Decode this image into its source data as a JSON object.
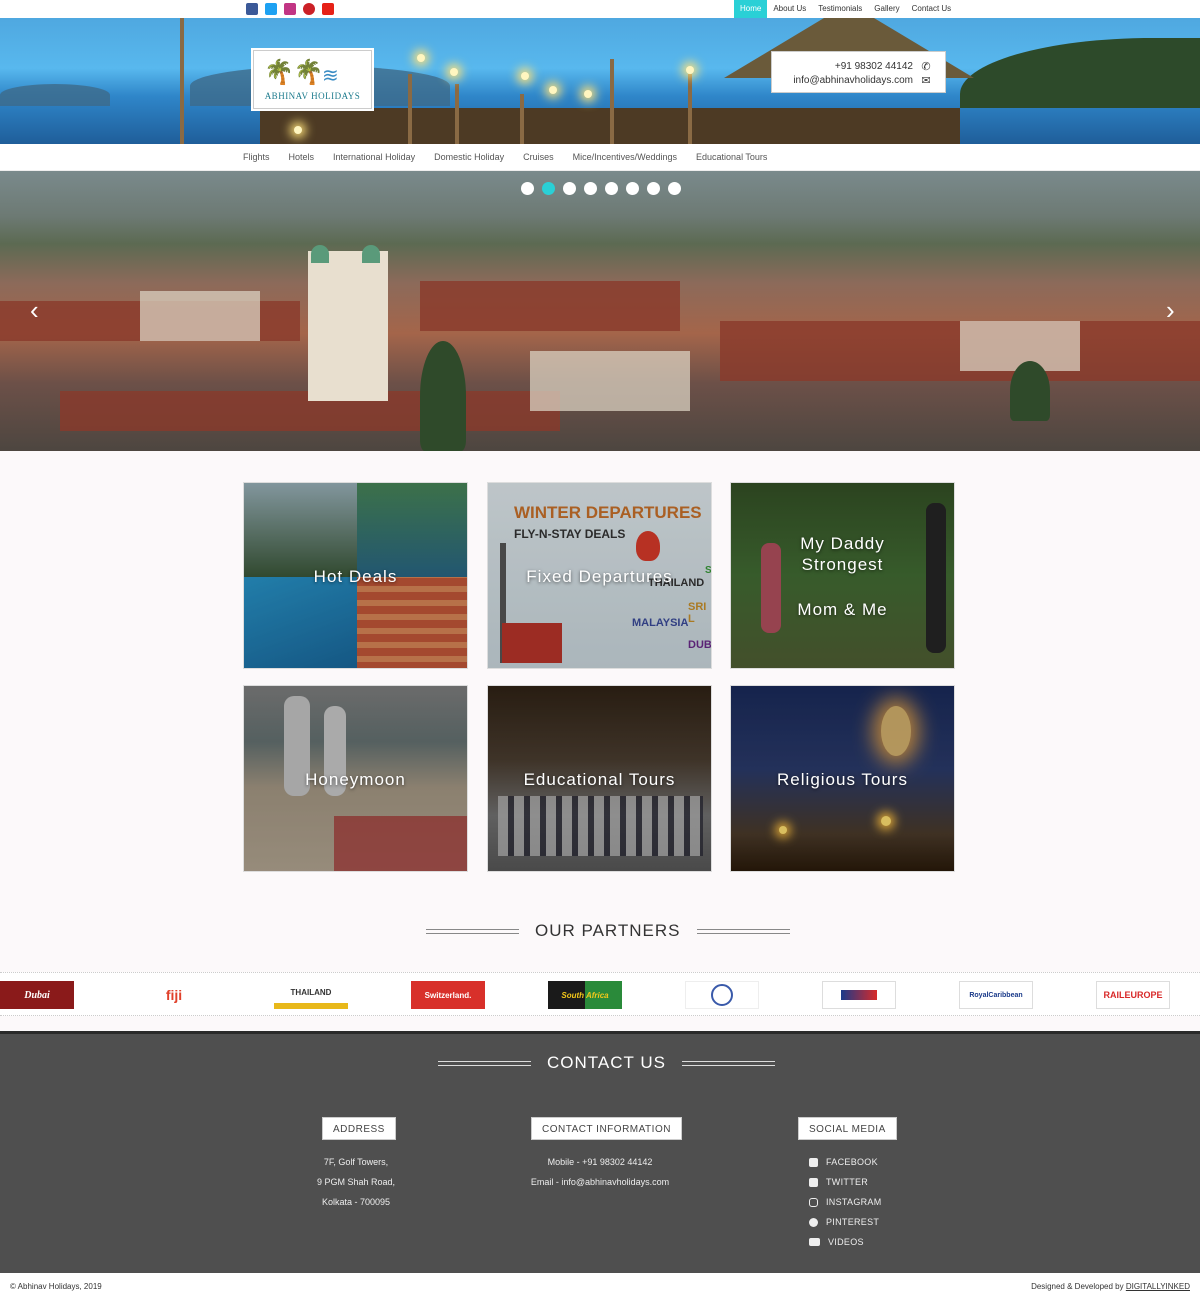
{
  "social_top": [
    "facebook-icon",
    "twitter-icon",
    "instagram-icon",
    "pinterest-icon",
    "youtube-icon"
  ],
  "top_nav": [
    "Home",
    "About Us",
    "Testimonials",
    "Gallery",
    "Contact Us"
  ],
  "brand": {
    "name": "ABHINAV HOLIDAYS"
  },
  "contact_box": {
    "phone": "+91 98302 44142",
    "email": "info@abhinavholidays.com"
  },
  "main_nav": [
    "Flights",
    "Hotels",
    "International Holiday",
    "Domestic Holiday",
    "Cruises",
    "Mice/Incentives/Weddings",
    "Educational Tours"
  ],
  "slider": {
    "dots": 8,
    "active_dot": 2
  },
  "tiles": [
    {
      "label": "Hot Deals"
    },
    {
      "label": "Fixed Departures",
      "art_text": [
        "WINTER DEPARTURES",
        "FLY-N-STAY DEALS",
        "THAILAND",
        "MALAYSIA",
        "SRI L",
        "DUBA",
        "SI"
      ]
    },
    {
      "label": "My Daddy Strongest",
      "label2": "Mom & Me"
    },
    {
      "label": "Honeymoon"
    },
    {
      "label": "Educational Tours"
    },
    {
      "label": "Religious Tours"
    }
  ],
  "partners_title": "OUR PARTNERS",
  "partners": [
    "Dubai",
    "fiji",
    "THAILAND",
    "Switzerland.",
    "South Africa",
    "",
    "",
    "RoyalCaribbean",
    "RAILEUROPE"
  ],
  "contact": {
    "title": "CONTACT US",
    "address_head": "ADDRESS",
    "address_lines": [
      "7F, Golf Towers,",
      "9 PGM Shah Road,",
      "Kolkata - 700095"
    ],
    "info_head": "CONTACT INFORMATION",
    "info_lines": [
      "Mobile - +91 98302 44142",
      "Email - info@abhinavholidays.com"
    ],
    "social_head": "SOCIAL MEDIA",
    "social_links": [
      "FACEBOOK",
      "TWITTER",
      "INSTAGRAM",
      "PINTEREST",
      "VIDEOS"
    ]
  },
  "footer": {
    "copyright": "© Abhinav Holidays, 2019",
    "credit": "Designed & Developed by",
    "credit_brand": "DIGITALLYINKED"
  },
  "colors": {
    "accent": "#2ad0d6",
    "footer_bg": "#4f4f4f"
  }
}
